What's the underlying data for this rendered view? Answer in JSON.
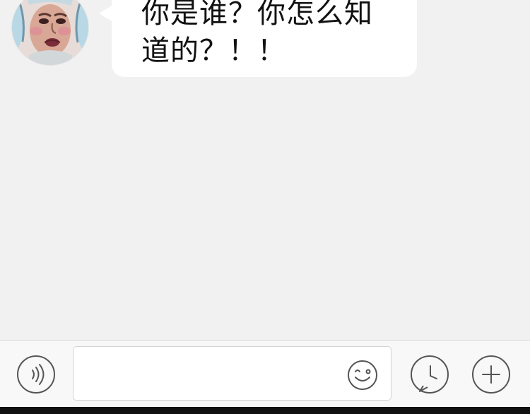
{
  "chat": {
    "messages": [
      {
        "sender": "incoming",
        "text": "你是谁？你怎么知\n道的？！！"
      }
    ]
  },
  "composer": {
    "value": "",
    "placeholder": ""
  },
  "icons": {
    "voice": "voice-icon",
    "emoji": "smile-icon",
    "clock": "clock-icon",
    "add": "plus-icon"
  },
  "colors": {
    "chat_background": "#f1f1f1",
    "input_bar_background": "#f8f8f8",
    "bubble_background": "#ffffff",
    "icon_stroke": "#555555"
  }
}
